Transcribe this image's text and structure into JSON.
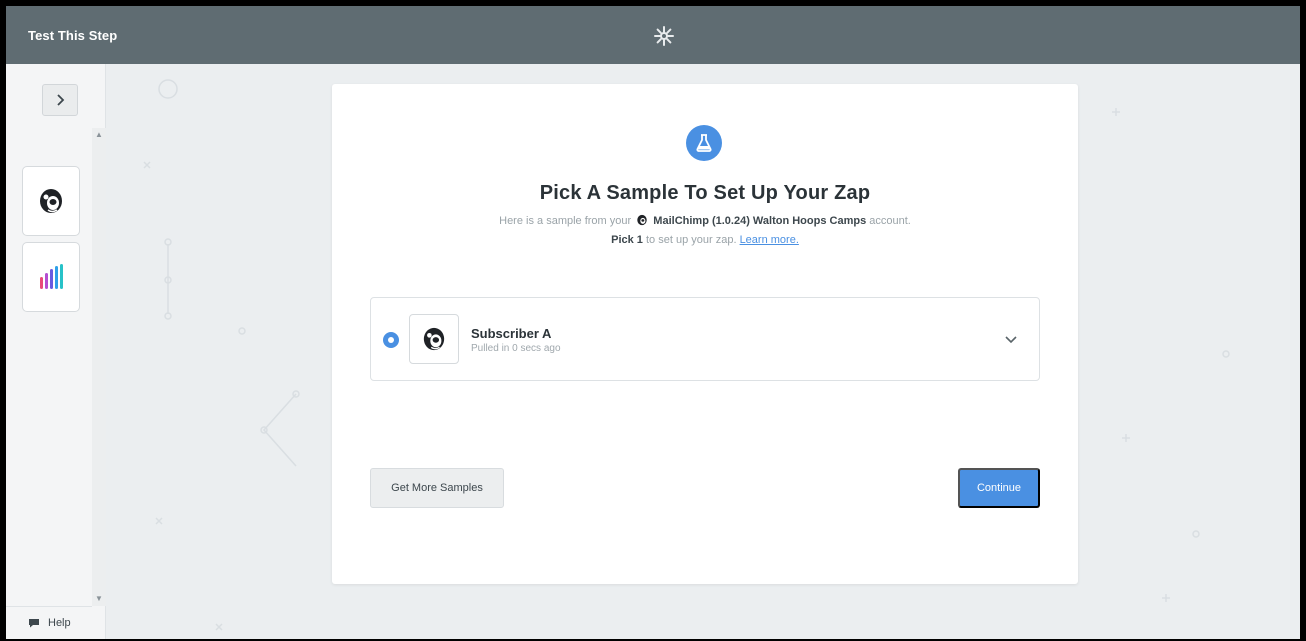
{
  "topbar": {
    "title": "Test This Step",
    "center_icon": "gear-icon"
  },
  "sidebar": {
    "toggle_icon": "chevron-right-icon",
    "steps": [
      {
        "app": "MailChimp",
        "icon": "mailchimp-icon"
      },
      {
        "app": "Analytics",
        "icon": "bar-chart-icon"
      }
    ],
    "help_label": "Help",
    "help_icon": "chat-bubble-icon"
  },
  "panel": {
    "icon": "flask-icon",
    "heading": "Pick A Sample To Set Up Your Zap",
    "sub_prefix": "Here is a sample from your",
    "account_app": "MailChimp (1.0.24) Walton Hoops Camps",
    "sub_suffix": "account.",
    "pick_bold": "Pick 1",
    "pick_rest": "to set up your zap.",
    "learn_more": "Learn more.",
    "samples": [
      {
        "name": "Subscriber A",
        "meta": "Pulled in 0 secs ago",
        "selected": true
      }
    ],
    "get_more_label": "Get More Samples",
    "continue_label": "Continue"
  },
  "colors": {
    "accent": "#4a90e2",
    "topbar": "#5f6c72",
    "background": "#ebeef0"
  }
}
